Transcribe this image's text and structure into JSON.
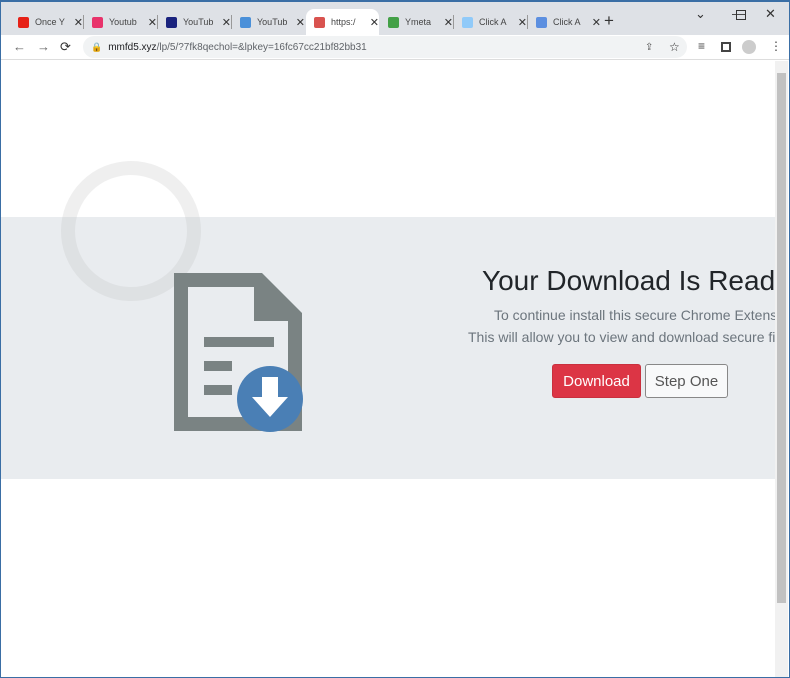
{
  "tabs": [
    {
      "label": "Once Y",
      "color": "#e62117"
    },
    {
      "label": "Youtub",
      "color": "#e8336b"
    },
    {
      "label": "YouTub",
      "color": "#1a237e"
    },
    {
      "label": "YouTub",
      "color": "#4a90d9"
    },
    {
      "label": "https:/",
      "color": "#d9534f",
      "active": true
    },
    {
      "label": "Ymeta",
      "color": "#43a047"
    },
    {
      "label": "Click A",
      "color": "#90caf9"
    },
    {
      "label": "Click A",
      "color": "#5c8fe0"
    }
  ],
  "address": {
    "host": "mmfd5.xyz",
    "path": "/lp/5/?7fk8qechol=&lpkey=16fc67cc21bf82bb31"
  },
  "page": {
    "heading": "Your Download Is Ready",
    "line1": "To continue install this secure Chrome Extension",
    "line2": "This will allow you to view and download secure file",
    "download_label": "Download",
    "step_label": "Step One"
  },
  "colors": {
    "accent": "#dc3545",
    "icon": "#4a7fb5"
  }
}
